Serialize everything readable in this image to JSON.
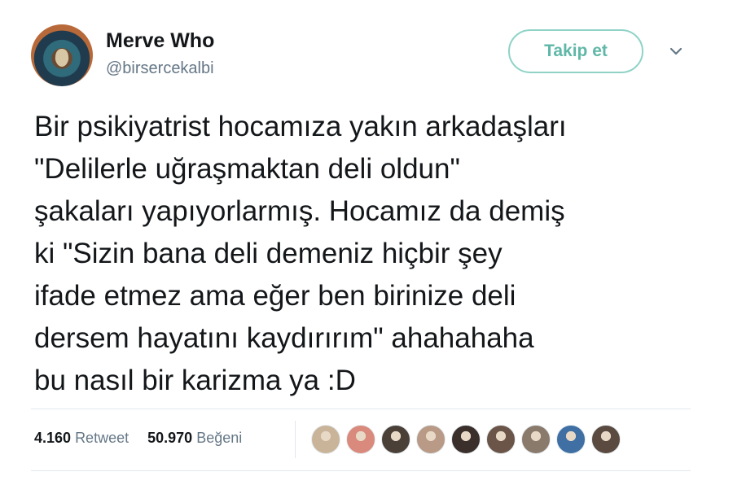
{
  "user": {
    "name": "Merve Who",
    "handle": "@birsercekalbi",
    "avatar_icon": "avatar-painting"
  },
  "actions": {
    "follow_label": "Takip et",
    "menu_icon": "chevron-down-icon"
  },
  "tweet": {
    "text": "Bir psikiyatrist hocamıza yakın arkadaşları\n\"Delilerle uğraşmaktan deli oldun\"\nşakaları yapıyorlarmış. Hocamız da demiş\nki \"Sizin bana deli demeniz hiçbir şey\nifade etmez ama eğer ben birinize deli\ndersem hayatını kaydırırım\" ahahahaha\nbu nasıl bir karizma ya :D"
  },
  "stats": {
    "retweet_count": "4.160",
    "retweet_label": "Retweet",
    "like_count": "50.970",
    "like_label": "Beğeni"
  },
  "likers": [
    {
      "icon": "liker-avatar-1",
      "color": "#c9b49a"
    },
    {
      "icon": "liker-avatar-2",
      "color": "#d98a7c"
    },
    {
      "icon": "liker-avatar-3",
      "color": "#4a4038"
    },
    {
      "icon": "liker-avatar-4",
      "color": "#b89a86"
    },
    {
      "icon": "liker-avatar-5",
      "color": "#3a2f2b"
    },
    {
      "icon": "liker-avatar-6",
      "color": "#6b5548"
    },
    {
      "icon": "liker-avatar-7",
      "color": "#8a7a6c"
    },
    {
      "icon": "liker-avatar-8",
      "color": "#3f6fa3"
    },
    {
      "icon": "liker-avatar-9",
      "color": "#5a4a3f"
    }
  ],
  "colors": {
    "accent": "#5fb7a7",
    "text": "#14171a",
    "muted": "#657786",
    "divider": "#e1e8ed"
  }
}
